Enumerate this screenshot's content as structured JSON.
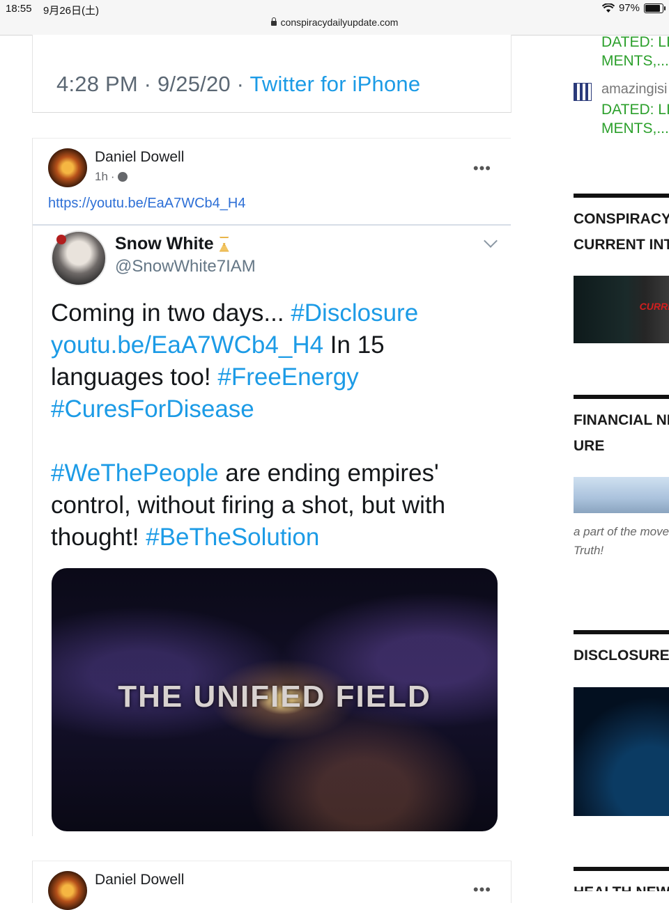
{
  "status": {
    "time": "18:55",
    "date": "9月26日(土)",
    "battery": "97%",
    "battery_level": 0.97
  },
  "browser": {
    "url": "conspiracydailyupdate.com"
  },
  "tweet_top": {
    "time": "4:28 PM",
    "sep": " · ",
    "date": "9/25/20",
    "source": "Twitter for iPhone"
  },
  "fb_post": {
    "author": "Daniel Dowell",
    "time": "1h",
    "link": "https://youtu.be/EaA7WCb4_H4",
    "more": "•••",
    "embedded_tweet": {
      "name": "Snow White",
      "handle": "@SnowWhite7IAM",
      "paragraph1": [
        {
          "text": "Coming in two days... ",
          "tag": false
        },
        {
          "text": "#Disclosure",
          "tag": true
        },
        {
          "text": " youtu.be/EaA7WCb4_H4",
          "tag": true
        },
        {
          "text": " In 15 languages too! ",
          "tag": false
        },
        {
          "text": "#FreeEnergy",
          "tag": true
        },
        {
          "text": " #CuresForDisease",
          "tag": true
        }
      ],
      "paragraph2": [
        {
          "text": "#WeThePeople",
          "tag": true
        },
        {
          "text": " are ending empires' control, without firing a shot, but with thought! ",
          "tag": false
        },
        {
          "text": "#BeTheSolution",
          "tag": true
        }
      ],
      "media_title": "THE UNIFIED FIELD"
    }
  },
  "fb_post2": {
    "author": "Daniel Dowell",
    "more": "•••"
  },
  "sidebar": {
    "comment1": {
      "line1": "DATED: LI",
      "line2": "MENTS,..."
    },
    "comment2": {
      "author": "amazingisi",
      "line1": "DATED: LI",
      "line2": "MENTS,..."
    },
    "sections": [
      {
        "title_line1": "CONSPIRACY",
        "title_line2": "CURRENT INT",
        "thumb_word": "CURRI"
      },
      {
        "title_line1": "FINANCIAL NI",
        "title_line2": "URE",
        "excerpt_line1": "a part of the mover",
        "excerpt_line2": "Truth!"
      },
      {
        "title_line1": "DISCLOSURE ("
      },
      {
        "title_line1": "HEALTH NEW"
      }
    ]
  },
  "colors": {
    "link_blue": "#1c9be6",
    "comment_green": "#2ca02c",
    "fb_link": "#2d6fd6"
  }
}
